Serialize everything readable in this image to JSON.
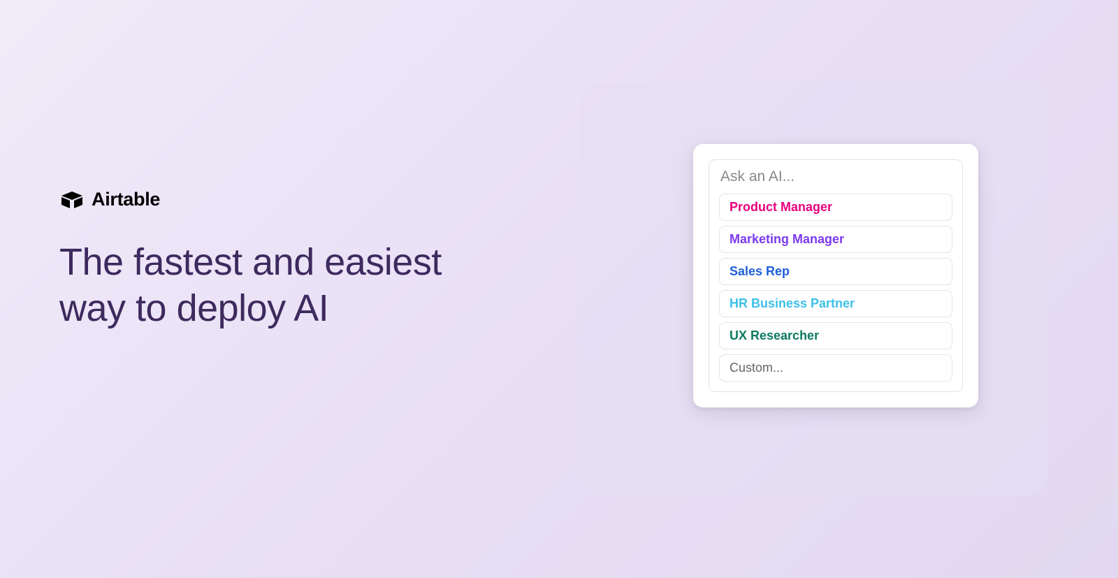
{
  "brand": {
    "name": "Airtable"
  },
  "headline": {
    "line1": "The fastest and easiest",
    "line2": "way to deploy AI"
  },
  "card": {
    "input_placeholder": "Ask an AI...",
    "options": [
      {
        "label": "Product Manager",
        "color": "pink"
      },
      {
        "label": "Marketing Manager",
        "color": "purple"
      },
      {
        "label": "Sales Rep",
        "color": "blue"
      },
      {
        "label": "HR Business Partner",
        "color": "cyan"
      },
      {
        "label": "UX Researcher",
        "color": "green"
      },
      {
        "label": "Custom...",
        "color": "gray"
      }
    ]
  }
}
